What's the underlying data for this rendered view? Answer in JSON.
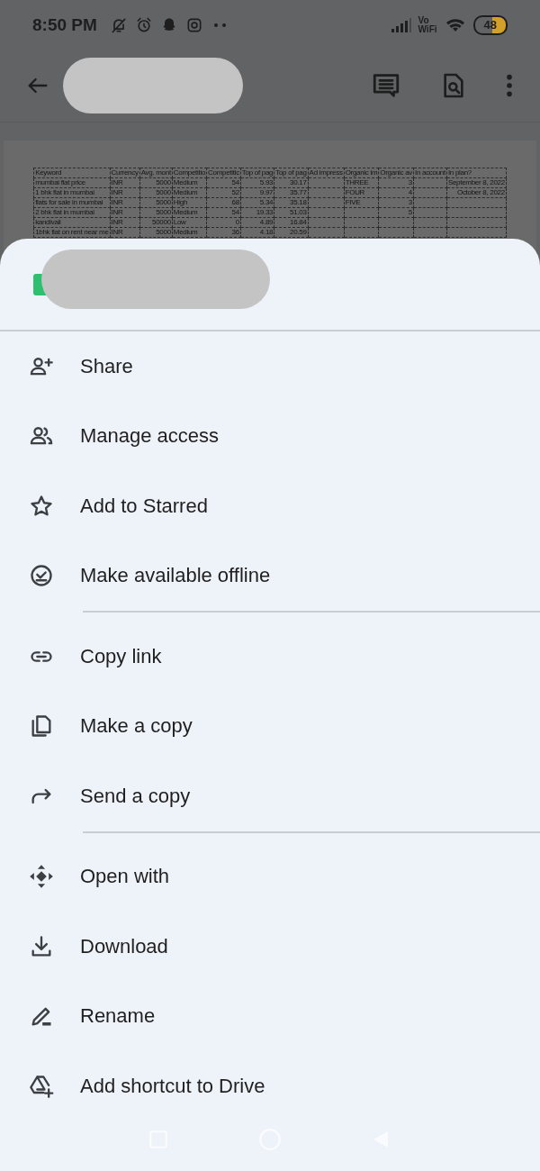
{
  "status_bar": {
    "time": "8:50 PM",
    "network_label": [
      "Vo",
      "WiFi"
    ],
    "battery": "48"
  },
  "preview": {
    "table": {
      "columns": [
        "Keyword",
        "Currency",
        "Avg. mont",
        "Competitio",
        "Competitic",
        "Top of pag",
        "Top of pag",
        "Ad impress",
        "Organic im",
        "Organic av",
        "In account",
        "In plan?"
      ],
      "rows": [
        [
          "mumbai flat price",
          "INR",
          "5000",
          "Medium",
          "54",
          "5.93",
          "30.17",
          "",
          "THREE",
          "3",
          "",
          "September 8, 2022"
        ],
        [
          "1 bhk flat in mumbai",
          "INR",
          "5000",
          "Medium",
          "52",
          "9.97",
          "35.77",
          "",
          "FOUR",
          "4",
          "",
          "October 8, 2022"
        ],
        [
          "flats for sale in mumbai",
          "INR",
          "5000",
          "High",
          "68",
          "5.34",
          "35.18",
          "",
          "FIVE",
          "3",
          "",
          ""
        ],
        [
          "2 bhk flat in mumbai",
          "INR",
          "5000",
          "Medium",
          "54",
          "19.33",
          "51.03",
          "",
          "",
          "5",
          "",
          ""
        ],
        [
          "kandivali",
          "INR",
          "50000",
          "Low",
          "0",
          "4.89",
          "16.84",
          "",
          "",
          "",
          "",
          ""
        ],
        [
          "1bhk flat on rent near me",
          "INR",
          "5000",
          "Medium",
          "36",
          "4.18",
          "20.59",
          "",
          "",
          "",
          "",
          ""
        ]
      ]
    }
  },
  "menu_groups": [
    {
      "items": [
        {
          "label": "Share"
        },
        {
          "label": "Manage access"
        },
        {
          "label": "Add to Starred"
        },
        {
          "label": "Make available offline"
        }
      ]
    },
    {
      "items": [
        {
          "label": "Copy link"
        },
        {
          "label": "Make a copy"
        },
        {
          "label": "Send a copy"
        }
      ]
    },
    {
      "items": [
        {
          "label": "Open with"
        },
        {
          "label": "Download"
        },
        {
          "label": "Rename"
        },
        {
          "label": "Add shortcut to Drive"
        }
      ]
    }
  ]
}
